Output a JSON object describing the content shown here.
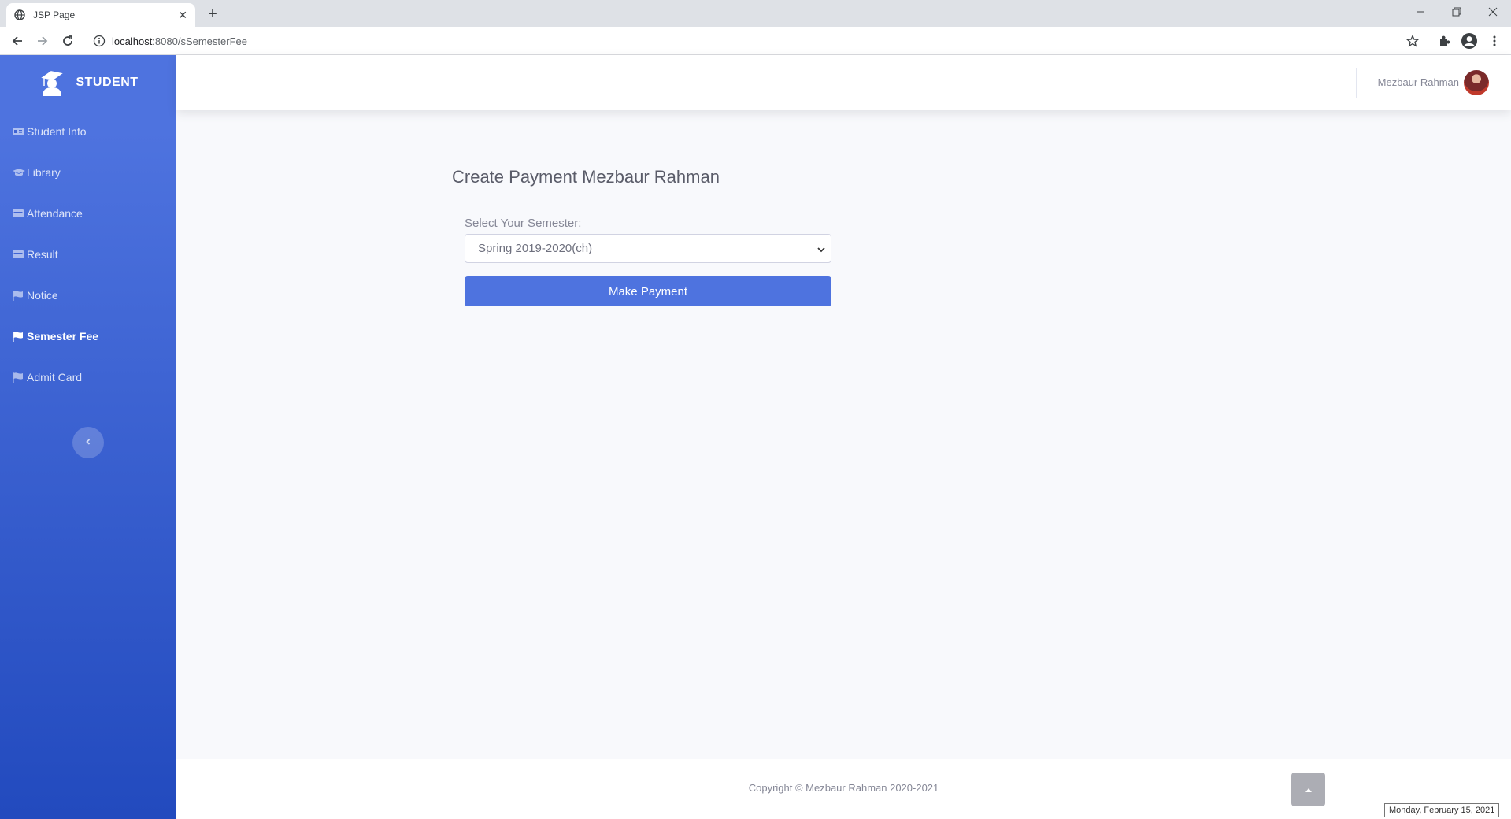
{
  "browser": {
    "tab_title": "JSP Page",
    "url_host": "localhost:",
    "url_port_path": "8080/sSemesterFee"
  },
  "sidebar": {
    "brand": "STUDENT",
    "items": [
      {
        "label": "Student Info",
        "icon": "id-card-icon"
      },
      {
        "label": "Library",
        "icon": "graduation-cap-icon"
      },
      {
        "label": "Attendance",
        "icon": "table-icon"
      },
      {
        "label": "Result",
        "icon": "table-icon"
      },
      {
        "label": "Notice",
        "icon": "flag-icon"
      },
      {
        "label": "Semester Fee",
        "icon": "flag-icon",
        "active": true
      },
      {
        "label": "Admit Card",
        "icon": "flag-icon"
      }
    ]
  },
  "topbar": {
    "user_name": "Mezbaur Rahman"
  },
  "main": {
    "title": "Create Payment Mezbaur Rahman",
    "semester_label": "Select Your Semester:",
    "semester_selected": "Spring 2019-2020(ch)",
    "pay_button": "Make Payment"
  },
  "footer": {
    "copyright": "Copyright © Mezbaur Rahman 2020-2021"
  },
  "tooltip": {
    "date": "Monday, February 15, 2021"
  },
  "colors": {
    "primary": "#4e73df",
    "sidebar_bottom": "#224abe",
    "content_bg": "#f8f9fc"
  }
}
